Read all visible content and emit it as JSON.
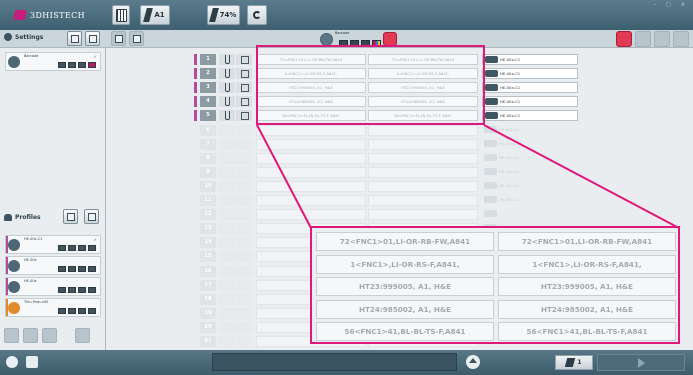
{
  "app": {
    "brand": "3DHISTECH"
  },
  "toolbar": {
    "slots_label": "A1",
    "zoom_label": "74%",
    "window_controls": [
      "–",
      "□",
      "×"
    ]
  },
  "settings": {
    "title": "Settings",
    "card": {
      "name": "Barcode",
      "check": "✓"
    }
  },
  "barcode_center": {
    "label": "Barcode"
  },
  "profiles": {
    "title": "Profiles",
    "items": [
      {
        "name": "HE-00x-C1",
        "check": "✓",
        "color": "#b64aa0"
      },
      {
        "name": "HE-00x",
        "check": "",
        "color": "#b64aa0"
      },
      {
        "name": "HE-00x",
        "check": "",
        "color": "#b64aa0"
      },
      {
        "name": "Thin-Prep-x50",
        "check": "",
        "color": "#e08a2c"
      }
    ]
  },
  "rows": [
    {
      "num": "1",
      "barcode1": "72<FNC1>01,LI-OR-RB-FW,A841",
      "barcode2": "72<FNC1>01,LI-OR-RB-FW,A841",
      "profile": "HE-00x-C1"
    },
    {
      "num": "2",
      "barcode1": "1<FNC1>,LI-OR-RS-F,A841,",
      "barcode2": "1<FNC1>,LI-OR-RS-F,A841,",
      "profile": "HE-00x-C1"
    },
    {
      "num": "3",
      "barcode1": "HT23:999005, A1, H&E",
      "barcode2": "HT23:999005, A1, H&E",
      "profile": "HE-00x-C1"
    },
    {
      "num": "4",
      "barcode1": "HT24:985002, A1, H&E",
      "barcode2": "HT24:985002, A1, H&E",
      "profile": "HE-00x-C1"
    },
    {
      "num": "5",
      "barcode1": "56<FNC1>41,BL-BL-TS-F,A841",
      "barcode2": "56<FNC1>41,BL-BL-TS-F,A841",
      "profile": "HE-00x-C1"
    }
  ],
  "empty_rows": [
    {
      "num": "6",
      "profile": "HE-00x-C1"
    },
    {
      "num": "7",
      "profile": "HE-00x-C1"
    },
    {
      "num": "8",
      "profile": "HE-00x-C1"
    },
    {
      "num": "9",
      "profile": "HE-00x-C1"
    },
    {
      "num": "10",
      "profile": "HE-00x-C1"
    },
    {
      "num": "11",
      "profile": "HE-00x-C1"
    },
    {
      "num": "12",
      "profile": ""
    },
    {
      "num": "13",
      "profile": ""
    },
    {
      "num": "14",
      "profile": ""
    },
    {
      "num": "15",
      "profile": ""
    },
    {
      "num": "16",
      "profile": ""
    },
    {
      "num": "17",
      "profile": ""
    },
    {
      "num": "18",
      "profile": ""
    },
    {
      "num": "19",
      "profile": ""
    },
    {
      "num": "20",
      "profile": ""
    },
    {
      "num": "21",
      "profile": ""
    },
    {
      "num": "22",
      "profile": ""
    },
    {
      "num": "23",
      "profile": ""
    },
    {
      "num": "24",
      "profile": ""
    }
  ],
  "zoom_cells": [
    [
      "72<FNC1>01,LI-OR-RB-FW,A841",
      "72<FNC1>01,LI-OR-RB-FW,A841"
    ],
    [
      "1<FNC1>,LI-OR-RS-F,A841,",
      "1<FNC1>,LI-OR-RS-F,A841,"
    ],
    [
      "HT23:999005, A1, H&E",
      "HT23:999005, A1, H&E"
    ],
    [
      "HT24:985002, A1, H&E",
      "HT24:985002, A1, H&E"
    ],
    [
      "56<FNC1>41,BL-BL-TS-F,A841",
      "56<FNC1>41,BL-BL-TS-F,A841"
    ]
  ],
  "bottom": {
    "slide_count": "1"
  },
  "colors": {
    "highlight": "#e0187a",
    "accent": "#c61f7d",
    "profile_marker": "#b64aa0"
  }
}
